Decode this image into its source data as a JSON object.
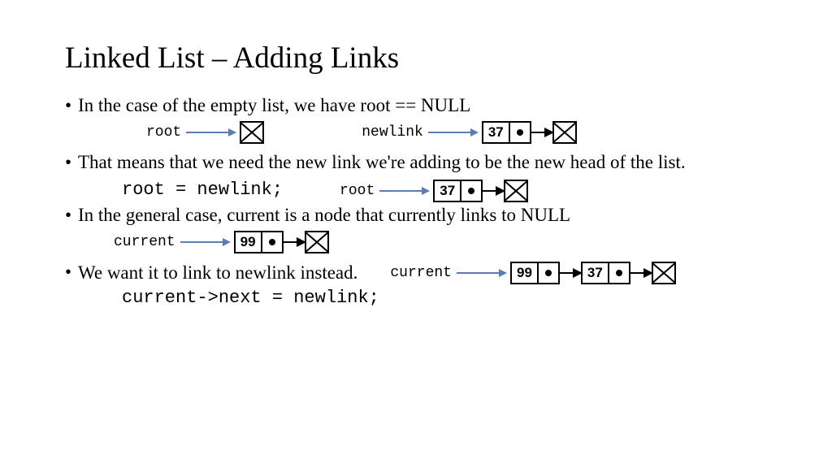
{
  "title": "Linked List – Adding Links",
  "bullets": {
    "b1": "In the case of the empty list, we have root == NULL",
    "b2": "That means that we need the new link we're adding to be the new head of the list.",
    "b3": "In the general case, current is a node that currently links to NULL",
    "b4": "We want it to link to newlink instead."
  },
  "code": {
    "c1": "root = newlink;",
    "c2": "current->next = newlink;"
  },
  "labels": {
    "root": "root",
    "newlink": "newlink",
    "current": "current"
  },
  "values": {
    "v37": "37",
    "v99": "99"
  }
}
